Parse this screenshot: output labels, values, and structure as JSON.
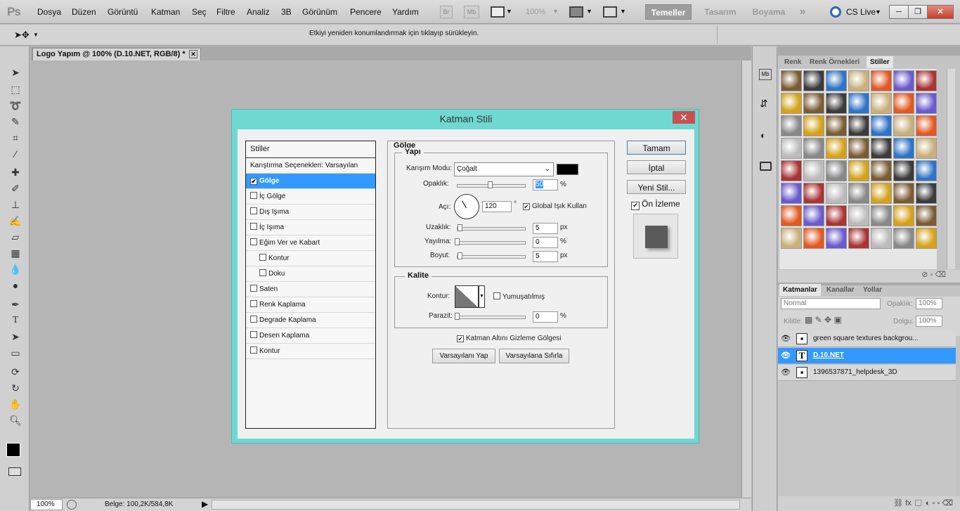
{
  "menubar": {
    "logo": "Ps",
    "items": [
      "Dosya",
      "Düzen",
      "Görüntü",
      "Katman",
      "Seç",
      "Filtre",
      "Analiz",
      "3B",
      "Görünüm",
      "Pencere",
      "Yardım"
    ],
    "br": "Br",
    "mb": "Mb",
    "zoom": "100%",
    "workspaces": [
      "Temeller",
      "Tasarım",
      "Boyama"
    ],
    "more": "»",
    "cslive": "CS Live"
  },
  "options": {
    "hint": "Etkiyi yeniden konumlandırmak için tıklayıp sürükleyin."
  },
  "doc": {
    "tab_title": "Logo Yapım @ 100% (D.10.NET, RGB/8) *",
    "zoom": "100%",
    "size": "Belge: 100,2K/584,8K"
  },
  "dialog": {
    "title": "Katman Stili",
    "styles_header": "Stiller",
    "styles": [
      {
        "label": "Karıştırma Seçenekleri: Varsayılan",
        "checkbox": false,
        "checked": false,
        "selected": false,
        "indent": 0
      },
      {
        "label": "Gölge",
        "checkbox": true,
        "checked": true,
        "selected": true,
        "indent": 0
      },
      {
        "label": "İç Gölge",
        "checkbox": true,
        "checked": false,
        "selected": false,
        "indent": 0
      },
      {
        "label": "Dış Işıma",
        "checkbox": true,
        "checked": false,
        "selected": false,
        "indent": 0
      },
      {
        "label": "İç Işıma",
        "checkbox": true,
        "checked": false,
        "selected": false,
        "indent": 0
      },
      {
        "label": "Eğim Ver ve Kabart",
        "checkbox": true,
        "checked": false,
        "selected": false,
        "indent": 0
      },
      {
        "label": "Kontur",
        "checkbox": true,
        "checked": false,
        "selected": false,
        "indent": 1
      },
      {
        "label": "Doku",
        "checkbox": true,
        "checked": false,
        "selected": false,
        "indent": 1
      },
      {
        "label": "Saten",
        "checkbox": true,
        "checked": false,
        "selected": false,
        "indent": 0
      },
      {
        "label": "Renk Kaplama",
        "checkbox": true,
        "checked": false,
        "selected": false,
        "indent": 0
      },
      {
        "label": "Degrade Kaplama",
        "checkbox": true,
        "checked": false,
        "selected": false,
        "indent": 0
      },
      {
        "label": "Desen Kaplama",
        "checkbox": true,
        "checked": false,
        "selected": false,
        "indent": 0
      },
      {
        "label": "Kontur",
        "checkbox": true,
        "checked": false,
        "selected": false,
        "indent": 0
      }
    ],
    "section_title": "Gölge",
    "structure": {
      "title": "Yapı",
      "blend_label": "Karışım Modu:",
      "blend_value": "Çoğalt",
      "opacity_label": "Opaklık:",
      "opacity": "50",
      "pct": "%",
      "angle_label": "Açı:",
      "angle": "120",
      "deg": "°",
      "global_light": "Global Işık Kullan",
      "distance_label": "Uzaklık:",
      "distance": "5",
      "spread_label": "Yayılma:",
      "spread": "0",
      "size_label": "Boyut:",
      "size": "5",
      "px": "px"
    },
    "quality": {
      "title": "Kalite",
      "contour_label": "Kontur:",
      "antialias": "Yumuşatılmış",
      "noise_label": "Parazit:",
      "noise": "0",
      "pct": "%"
    },
    "knockout": "Katman Altını Gizleme Gölgesi",
    "make_default": "Varsayılanı Yap",
    "reset_default": "Varsayılana Sıfırla",
    "ok": "Tamam",
    "cancel": "İptal",
    "new_style": "Yeni Stil...",
    "preview": "Ön İzleme"
  },
  "styles_panel": {
    "tabs": [
      "Renk",
      "Renk Örnekleri",
      "Stiller"
    ]
  },
  "layers_panel": {
    "tabs": [
      "Katmanlar",
      "Kanallar",
      "Yollar"
    ],
    "blend": "Normal",
    "opacity_label": "Opaklık:",
    "opacity": "100%",
    "lock_label": "Kilitle:",
    "fill_label": "Dolgu:",
    "fill": "100%",
    "layers": [
      {
        "name": "green square textures backgrou...",
        "type": "smart",
        "selected": false
      },
      {
        "name": "D.10.NET",
        "type": "text",
        "selected": true
      },
      {
        "name": "1396537871_helpdesk_3D",
        "type": "smart",
        "selected": false
      }
    ]
  }
}
